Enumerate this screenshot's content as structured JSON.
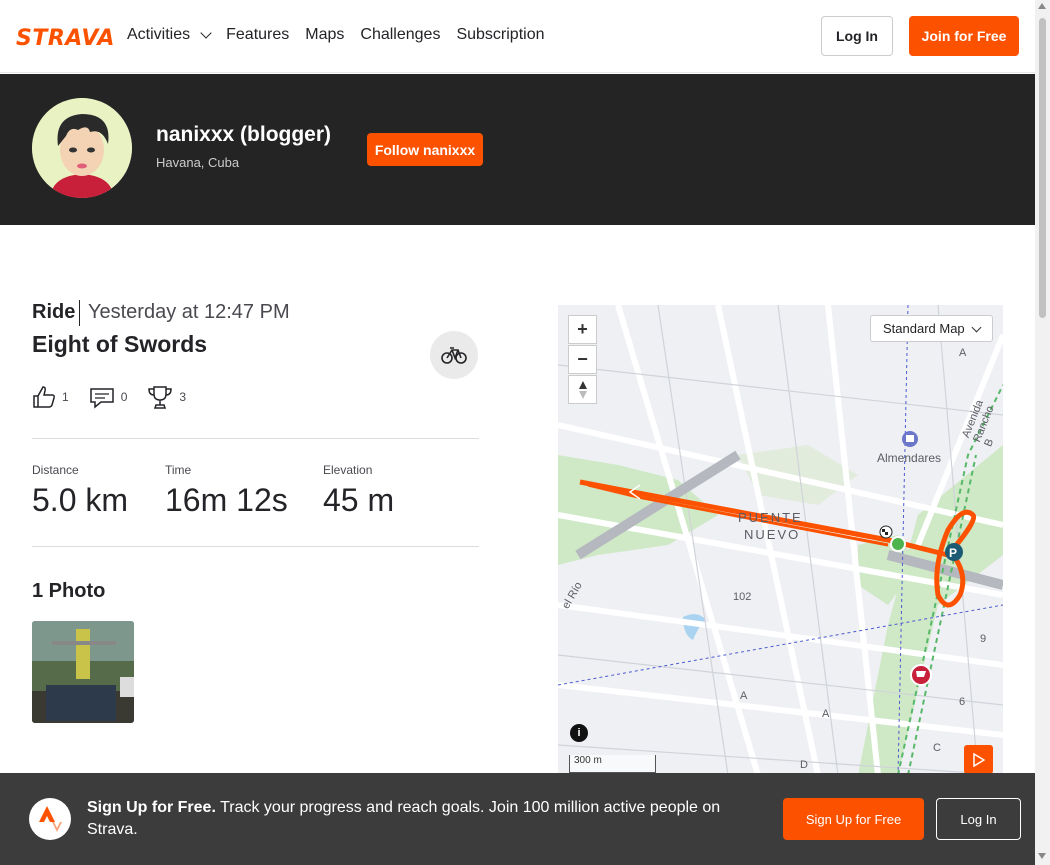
{
  "header": {
    "logo": "STRAVA",
    "nav": [
      "Activities",
      "Features",
      "Maps",
      "Challenges",
      "Subscription"
    ],
    "login_label": "Log In",
    "join_label": "Join for Free"
  },
  "athlete": {
    "name": "nanixxx (blogger)",
    "location": "Havana, Cuba",
    "follow_label": "Follow nanixxx"
  },
  "activity": {
    "type": "Ride",
    "time": "Yesterday at 12:47 PM",
    "title": "Eight of Swords",
    "kudos": "1",
    "comments": "0",
    "achievements": "3",
    "stats": [
      {
        "label": "Distance",
        "value": "5.0 km"
      },
      {
        "label": "Time",
        "value": "16m 12s"
      },
      {
        "label": "Elevation",
        "value": "45 m"
      }
    ],
    "photos_title": "1 Photo"
  },
  "map": {
    "style_select": "Standard Map",
    "zoom_in": "+",
    "zoom_out": "−",
    "labels": {
      "almendares": "Almendares",
      "puente": "PUENTE",
      "nuevo": "NUEVO",
      "road_102": "102",
      "avenida": "Avenida Rancho B",
      "rio": "el Río",
      "a1": "A",
      "a2": "A",
      "a3": "A",
      "d": "D",
      "c": "C",
      "n9": "9",
      "n6": "6"
    },
    "info": "i",
    "scale": "300 m"
  },
  "signup": {
    "bold": "Sign Up for Free.",
    "text": " Track your progress and reach goals. Join 100 million active people on Strava.",
    "signup_label": "Sign Up for Free",
    "login_label": "Log In"
  },
  "colors": {
    "brand": "#fc5200",
    "banner": "#242424",
    "signup_bar": "#3c3c3c"
  }
}
